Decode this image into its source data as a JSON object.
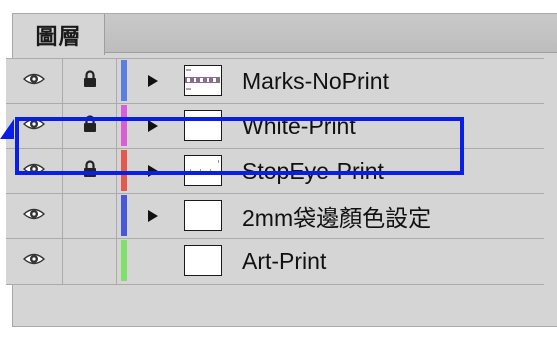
{
  "panel": {
    "tab_label": "圖層"
  },
  "layers": [
    {
      "name": "Marks-NoPrint",
      "visible": true,
      "locked": true,
      "color": "#5b7fe0",
      "expandable": true,
      "thumbnail": "marks-thumbnail",
      "selected": false
    },
    {
      "name": "White-Print",
      "visible": true,
      "locked": true,
      "color": "#d95fd6",
      "expandable": true,
      "thumbnail": "blank",
      "selected": true
    },
    {
      "name": "StopEye-Print",
      "visible": true,
      "locked": true,
      "color": "#e5584e",
      "expandable": true,
      "thumbnail": "stopeye-thumbnail",
      "selected": false
    },
    {
      "name": "2mm袋邊顏色設定",
      "visible": true,
      "locked": false,
      "color": "#4758d9",
      "expandable": true,
      "thumbnail": "blank",
      "selected": false
    },
    {
      "name": "Art-Print",
      "visible": true,
      "locked": false,
      "color": "#7fe06a",
      "expandable": false,
      "thumbnail": "blank",
      "selected": false
    }
  ],
  "icons": {
    "visibility": "eye-icon",
    "lock": "lock-icon",
    "expand": "triangle-right-icon"
  },
  "annotation": {
    "highlight_color": "#0a1fe6"
  }
}
